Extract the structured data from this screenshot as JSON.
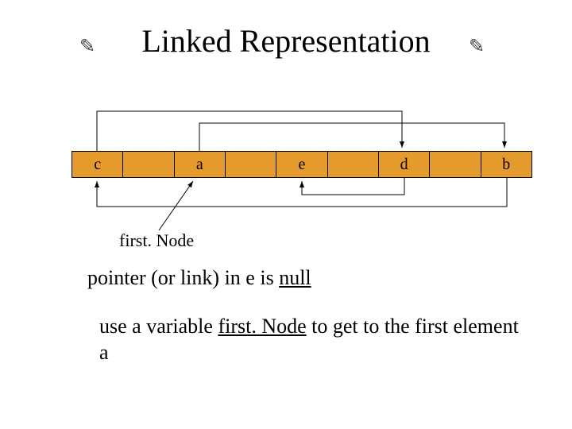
{
  "title": "Linked Representation",
  "nodes": {
    "c": "c",
    "a": "a",
    "e": "e",
    "d": "d",
    "b": "b"
  },
  "label_firstNode": "first. Node",
  "line1_a": "pointer (or link) in ",
  "line1_e": "e",
  "line1_b": " is ",
  "line1_null": "null",
  "line2_a": "use a variable ",
  "line2_fn": "first. Node",
  "line2_b": " to get to the first element ",
  "line2_last": "a"
}
